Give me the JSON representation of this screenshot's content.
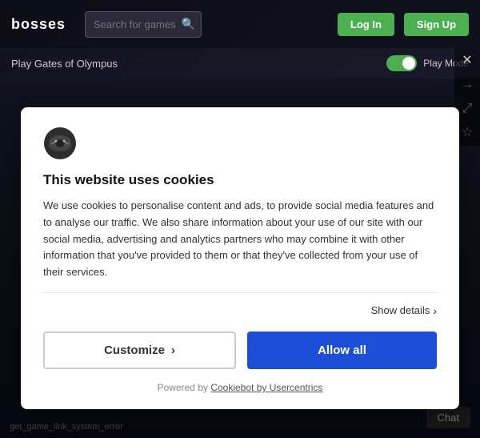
{
  "header": {
    "logo_text": "bosses",
    "logo_prefix": "…",
    "search_placeholder": "Search for games",
    "login_label": "Log In",
    "signup_label": "Sign Up"
  },
  "subheader": {
    "play_link": "Play Gates of Olympus",
    "play_mode_label": "Play Mode"
  },
  "sidebar": {
    "close_icon": "✕",
    "arrow_icon": "→",
    "expand_icon": "⤢",
    "star_icon": "☆"
  },
  "game_area": {
    "error_text": "get_game_link_system_error"
  },
  "chat": {
    "label": "Chat"
  },
  "cookie_modal": {
    "logo_alt": "Cookiebot logo",
    "title": "This website uses cookies",
    "body": "We use cookies to personalise content and ads, to provide social media features and to analyse our traffic. We also share information about your use of our site with our social media, advertising and analytics partners who may combine it with other information that you've provided to them or that they've collected from your use of their services.",
    "show_details_label": "Show details",
    "customize_label": "Customize",
    "customize_arrow": "›",
    "allow_all_label": "Allow all",
    "footer_powered": "Powered by",
    "footer_link_text": "Cookiebot by Usercentrics"
  }
}
